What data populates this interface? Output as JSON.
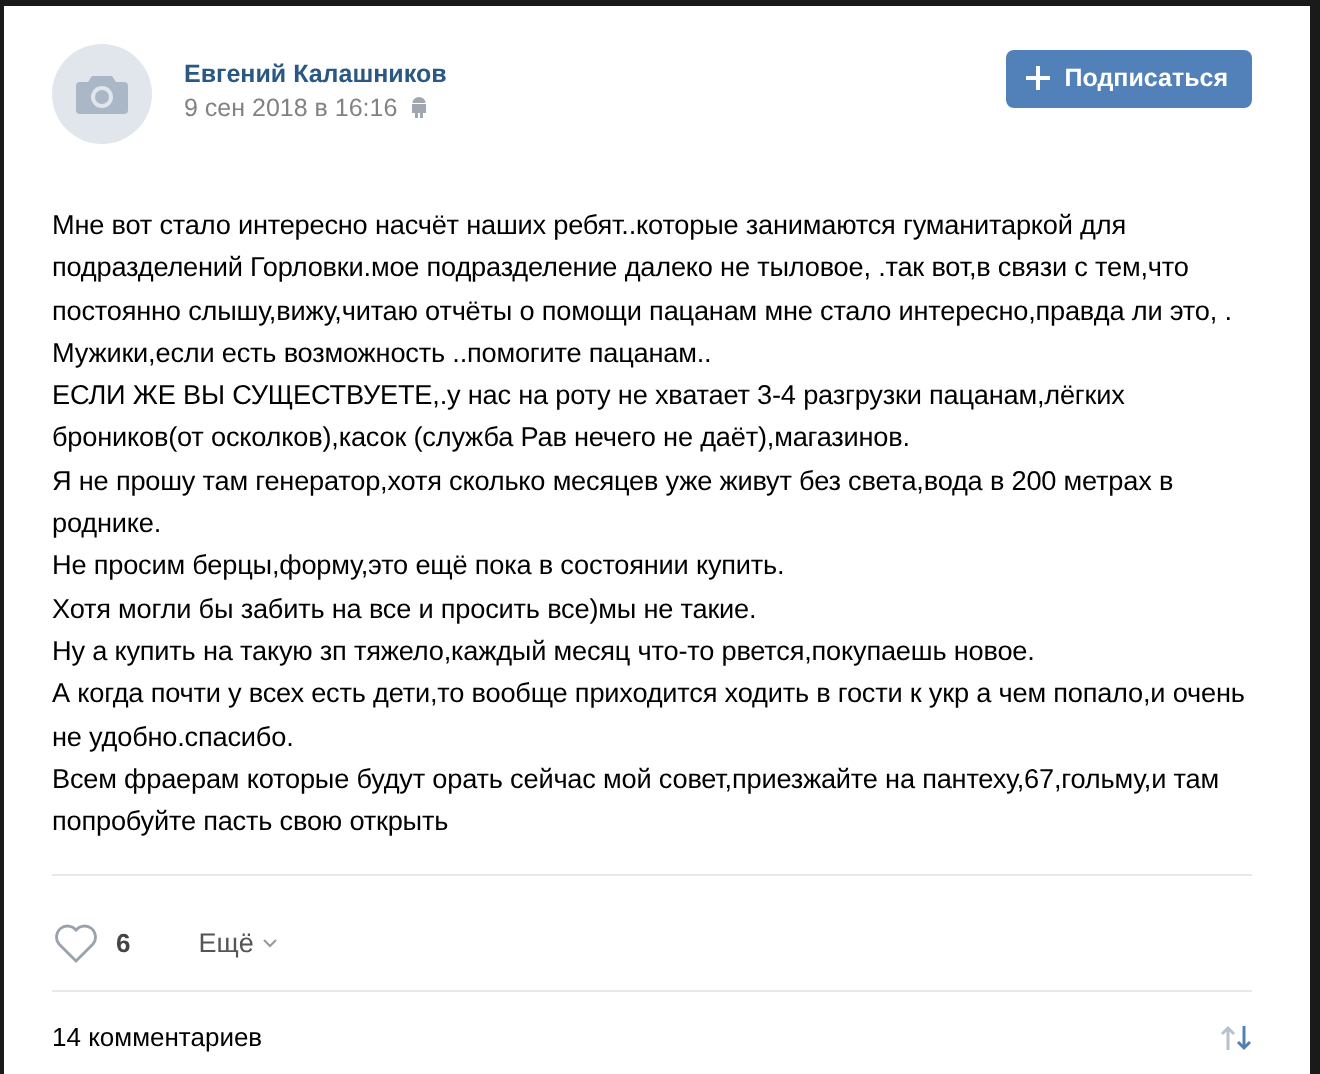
{
  "post": {
    "author": "Евгений Калашников",
    "date": "9 сен 2018 в 16:16",
    "subscribe_button": "Подписаться",
    "paragraphs": [
      "Мне вот стало интересно насчёт наших ребят..которые занимаются гуманитаркой для подразделений Горловки.мое подразделение далеко не тыловое, .так вот,в связи с тем,что постоянно слышу,вижу,читаю отчёты о помощи пацанам мне стало интересно,правда ли это, . Мужики,если есть возможность ..помогите пацанам..",
      "ЕСЛИ ЖЕ ВЫ СУЩЕСТВУЕТЕ,.у нас на роту не хватает 3-4 разгрузки пацанам,лёгких броников(от осколков),касок (служба Рав нечего не даёт),магазинов.",
      "Я не прошу там генератор,хотя сколько месяцев уже живут без света,вода в 200 метрах в роднике.",
      "Не просим берцы,форму,это ещё пока в состоянии купить.",
      "Хотя могли бы забить на все и просить все)мы не такие.",
      "Ну а купить на такую зп тяжело,каждый месяц что-то рвется,покупаешь новое.",
      "А когда почти у всех есть дети,то вообще приходится ходить в гости к укр а чем попало,и очень не удобно.спасибо.",
      "Всем фраерам которые будут орать сейчас мой совет,приезжайте на пантеху,67,гольму,и там попробуйте пасть свою открыть"
    ],
    "likes": {
      "count": "6",
      "liked": false
    },
    "more": "Ещё"
  },
  "comments": {
    "count": "14 комментариев"
  }
}
